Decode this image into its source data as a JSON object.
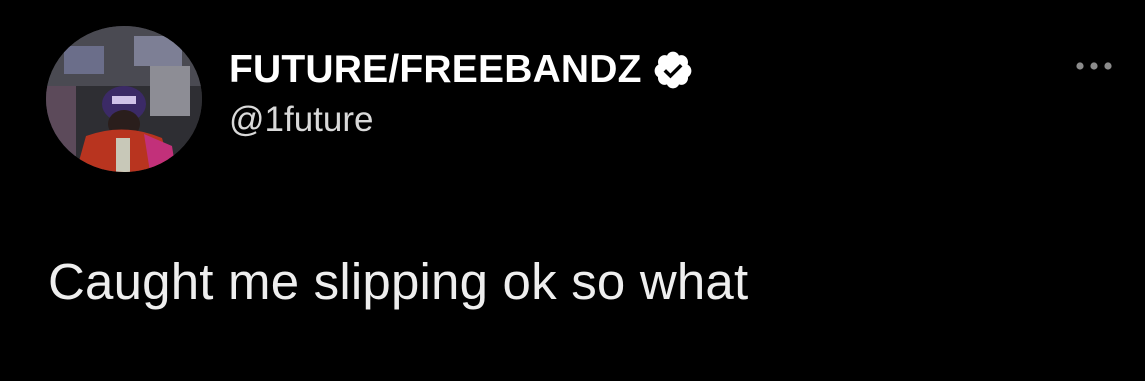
{
  "tweet": {
    "author": {
      "display_name": "FUTURE/FREEBANDZ",
      "handle": "@1future",
      "verified": true,
      "verified_icon": "verified-badge-icon"
    },
    "text": "Caught me slipping ok so what",
    "more_icon": "more-options-icon"
  },
  "colors": {
    "background": "#000000",
    "name": "#ffffff",
    "handle": "#d9d9d9",
    "text": "#eeeeee",
    "icon": "#8b8b8b"
  }
}
